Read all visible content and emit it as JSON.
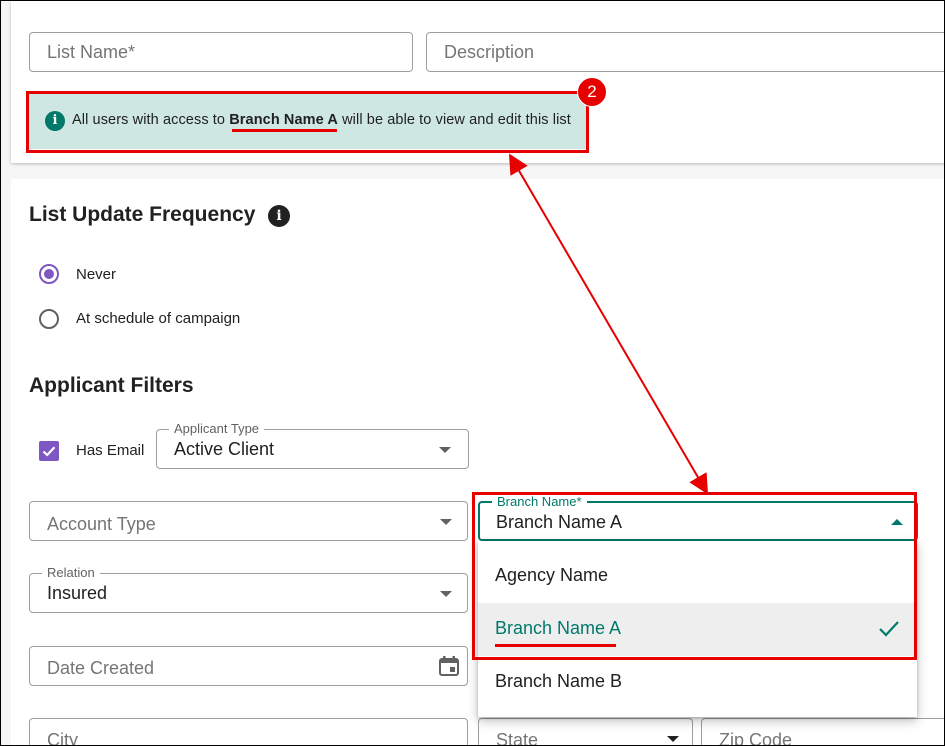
{
  "form": {
    "list_name_placeholder": "List Name*",
    "description_placeholder": "Description"
  },
  "banner": {
    "prefix": "All users with access to ",
    "branch": "Branch Name A",
    "suffix": " will be able to view and edit this list",
    "icon": "info-icon"
  },
  "annotation": {
    "badge_number": "2",
    "highlight_color": "#e60000"
  },
  "frequency": {
    "title": "List Update Frequency",
    "options": [
      {
        "label": "Never",
        "selected": true
      },
      {
        "label": "At schedule of campaign",
        "selected": false
      }
    ]
  },
  "filters": {
    "title": "Applicant Filters",
    "has_email_label": "Has Email",
    "has_email_checked": true,
    "applicant_type_label": "Applicant Type",
    "applicant_type_value": "Active Client",
    "account_type_placeholder": "Account Type",
    "relation_label": "Relation",
    "relation_value": "Insured",
    "date_created_placeholder": "Date Created",
    "city_placeholder": "City",
    "state_placeholder": "State",
    "zip_placeholder": "Zip Code",
    "branch_label": "Branch Name*",
    "branch_value": "Branch Name A",
    "branch_options": [
      "Agency Name",
      "Branch Name A",
      "Branch Name B"
    ],
    "branch_selected_index": 1
  },
  "colors": {
    "accent": "#00796b",
    "radio_checkbox": "#7e57c2",
    "banner_bg": "#cfe7e3"
  }
}
